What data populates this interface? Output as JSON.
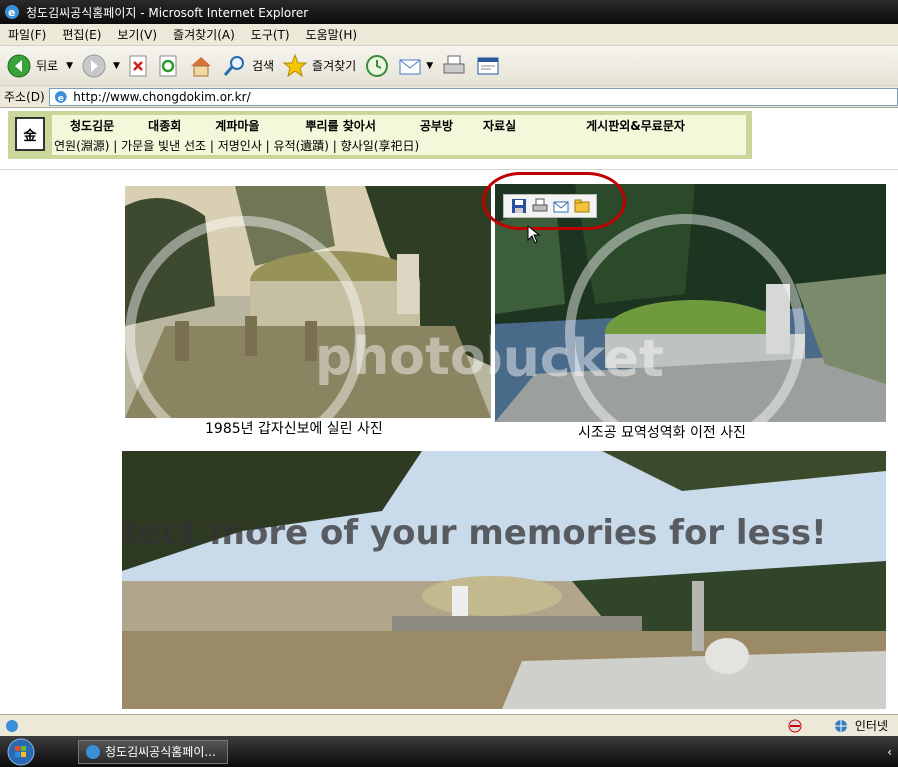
{
  "window": {
    "title": "청도김씨공식홈페이지 - Microsoft Internet Explorer"
  },
  "menu": [
    "파일(F)",
    "편집(E)",
    "보기(V)",
    "즐겨찾기(A)",
    "도구(T)",
    "도움말(H)"
  ],
  "toolbar": {
    "back_label": "뒤로",
    "search_label": "검색",
    "favorites_label": "즐겨찾기"
  },
  "address": {
    "label": "주소(D)",
    "value": "http://www.chongdokim.or.kr/"
  },
  "site": {
    "logo_text": "金",
    "nav": [
      "청도김문",
      "대종회",
      "계파마을",
      "뿌리를 찾아서",
      "공부방",
      "자료실",
      "게시판외&무료문자"
    ],
    "subnav": "연원(淵源) | 가문을 빛낸 선조 | 저명인사 | 유적(遺蹟) | 향사일(享祀日)"
  },
  "photos": {
    "left_caption": "1985년 갑자신보에 실린 사진",
    "right_caption": "시조공 묘역성역화 이전 사진",
    "watermark": "photobucket",
    "banner_text": "tect more of your memories for less!"
  },
  "statusbar": {
    "zone": "인터넷"
  },
  "taskbar": {
    "task_label": "청도김씨공식홈페이..."
  }
}
